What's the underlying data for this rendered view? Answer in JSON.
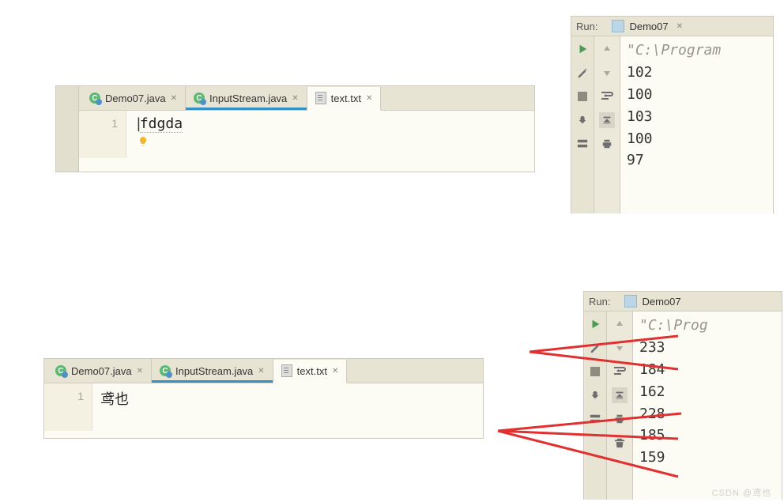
{
  "editor1": {
    "tabs": [
      {
        "name": "Demo07.java",
        "icon": "c-java",
        "active": false,
        "underlined": false
      },
      {
        "name": "InputStream.java",
        "icon": "c-java",
        "active": false,
        "underlined": true
      },
      {
        "name": "text.txt",
        "icon": "txt",
        "active": true,
        "underlined": false
      }
    ],
    "line_no": "1",
    "text": "fdgda"
  },
  "editor2": {
    "tabs": [
      {
        "name": "Demo07.java",
        "icon": "c-java",
        "active": false,
        "underlined": false
      },
      {
        "name": "InputStream.java",
        "icon": "c-java",
        "active": false,
        "underlined": true
      },
      {
        "name": "text.txt",
        "icon": "txt",
        "active": true,
        "underlined": false
      }
    ],
    "line_no": "1",
    "text": "鸢也"
  },
  "run1": {
    "label": "Run:",
    "config": "Demo07",
    "first_line": "\"C:\\Program",
    "output": [
      "102",
      "100",
      "103",
      "100",
      "97"
    ]
  },
  "run2": {
    "label": "Run:",
    "config": "Demo07",
    "first_line": "\"C:\\Prog",
    "output": [
      "233",
      "184",
      "162",
      "228",
      "185",
      "159"
    ]
  },
  "watermark": "CSDN @鸢也"
}
